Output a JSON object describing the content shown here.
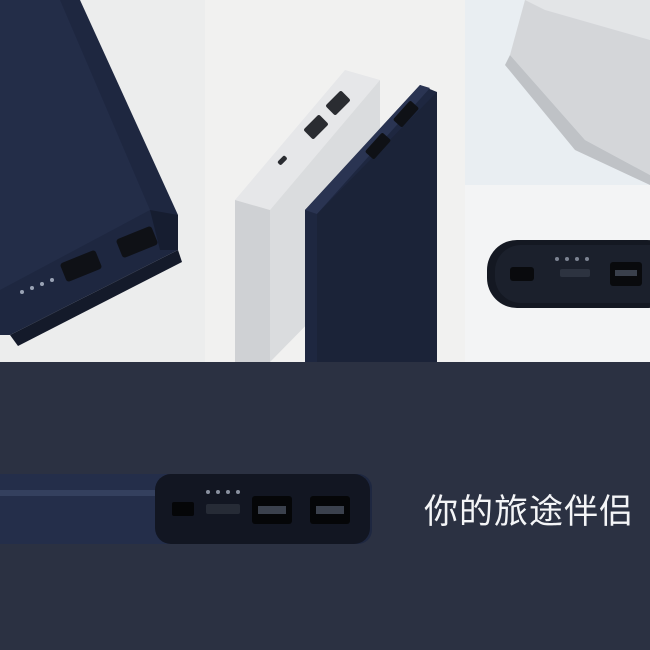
{
  "banner": {
    "tagline": "你的旅途伴侣"
  },
  "colors": {
    "navy_body": "#1e2740",
    "navy_dark": "#121826",
    "silver_body": "#d4d6d9",
    "background_light": "#efefef",
    "background_bottom": "#2b3142",
    "port_black": "#0f1116"
  },
  "images": [
    {
      "name": "navy-power-bank-closeup"
    },
    {
      "name": "silver-and-navy-power-banks-standing"
    },
    {
      "name": "silver-power-bank-corner"
    },
    {
      "name": "power-bank-ports-detail"
    },
    {
      "name": "navy-power-bank-side-profile"
    }
  ]
}
